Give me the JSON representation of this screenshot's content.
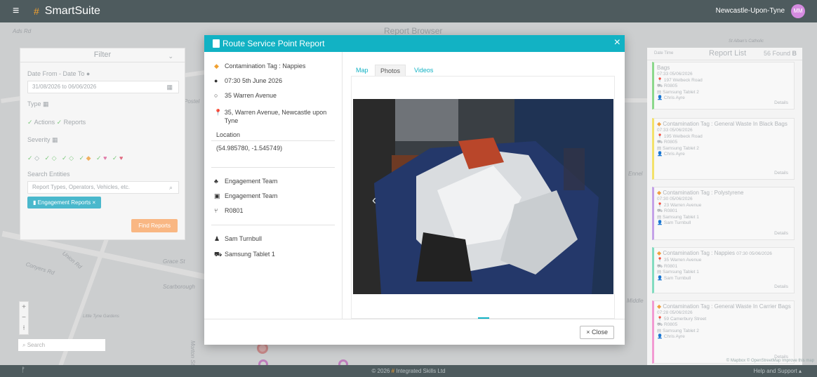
{
  "app": {
    "title": "SmartSuite",
    "location": "Newcastle-Upon-Tyne",
    "user_initials": "MM"
  },
  "background": {
    "title": "Report Browser"
  },
  "map_labels": [
    "Ads Rd",
    "Postel",
    "Conyers Rd",
    "Union Rd",
    "Grace St",
    "Scarborough",
    "Little Tyne Gardens",
    "Morton St",
    "Ennel",
    "Middle",
    "St Alban's Catholic"
  ],
  "map_search_placeholder": "Search",
  "map_attribution": "© Mapbox © OpenStreetMap Improve this map",
  "filter": {
    "title": "Filter",
    "date_label": "Date From - Date To",
    "date_value": "31/08/2026 to 06/06/2026",
    "type_label": "Type",
    "type_options": [
      "Actions",
      "Reports"
    ],
    "severity_label": "Severity",
    "search_label": "Search Entities",
    "search_placeholder": "Report Types, Operators, Vehicles, etc.",
    "chip": "Engagement Reports",
    "find_button": "Find Reports"
  },
  "report_list": {
    "title": "Report List",
    "count": "56 Found",
    "sort_label": "Date Time",
    "items": [
      {
        "title": "Bags",
        "time": "07:33 05/06/2026",
        "address": "197 Welbeck Road",
        "vehicle": "R0805",
        "device": "Samsung Tablet 2",
        "user": "Chris Ayre",
        "details": "Details",
        "color": "#8bd88b"
      },
      {
        "title": "Contamination Tag : General Waste In Black Bags",
        "time": "07:33 05/06/2026",
        "address": "195 Welbeck Road",
        "vehicle": "R0805",
        "device": "Samsung Tablet 2",
        "user": "Chris Ayre",
        "details": "Details",
        "color": "#f3e26a"
      },
      {
        "title": "Contamination Tag : Polystyrene",
        "time": "07:30 05/06/2026",
        "address": "23 Warren Avenue",
        "vehicle": "R0801",
        "device": "Samsung Tablet 1",
        "user": "Sam Turnbull",
        "details": "Details",
        "color": "#c4a2e8"
      },
      {
        "title": "Contamination Tag : Nappies",
        "time": "07:30 05/06/2026",
        "address": "35 Warren Avenue",
        "vehicle": "R0801",
        "device": "Samsung Tablet 1",
        "user": "Sam Turnbull",
        "details": "Details",
        "color": "#82dcc0"
      },
      {
        "title": "Contamination Tag : General Waste In Carrier Bags",
        "time": "07:28 05/06/2026",
        "address": "59 Camerbury Street",
        "vehicle": "R0805",
        "device": "Samsung Tablet 2",
        "user": "Chris Ayre",
        "details": "Details",
        "color": "#f29ad2"
      }
    ]
  },
  "footer": {
    "copyright": "© 2026",
    "company": "Integrated Skills Ltd",
    "help": "Help and Support"
  },
  "modal": {
    "title": "Route Service Point Report",
    "tag": "Contamination Tag : Nappies",
    "datetime": "07:30  5th June 2026",
    "address_short": "35 Warren Avenue",
    "address_full": "35, Warren Avenue, Newcastle upon Tyne",
    "location_label": "Location",
    "coordinates": "(54.985780, -1.545749)",
    "team": "Engagement Team",
    "team2": "Engagement Team",
    "vehicle": "R0801",
    "user": "Sam Turnbull",
    "device": "Samsung Tablet 1",
    "tabs": [
      "Map",
      "Photos",
      "Videos"
    ],
    "active_tab": "Photos",
    "close_button": "Close"
  }
}
